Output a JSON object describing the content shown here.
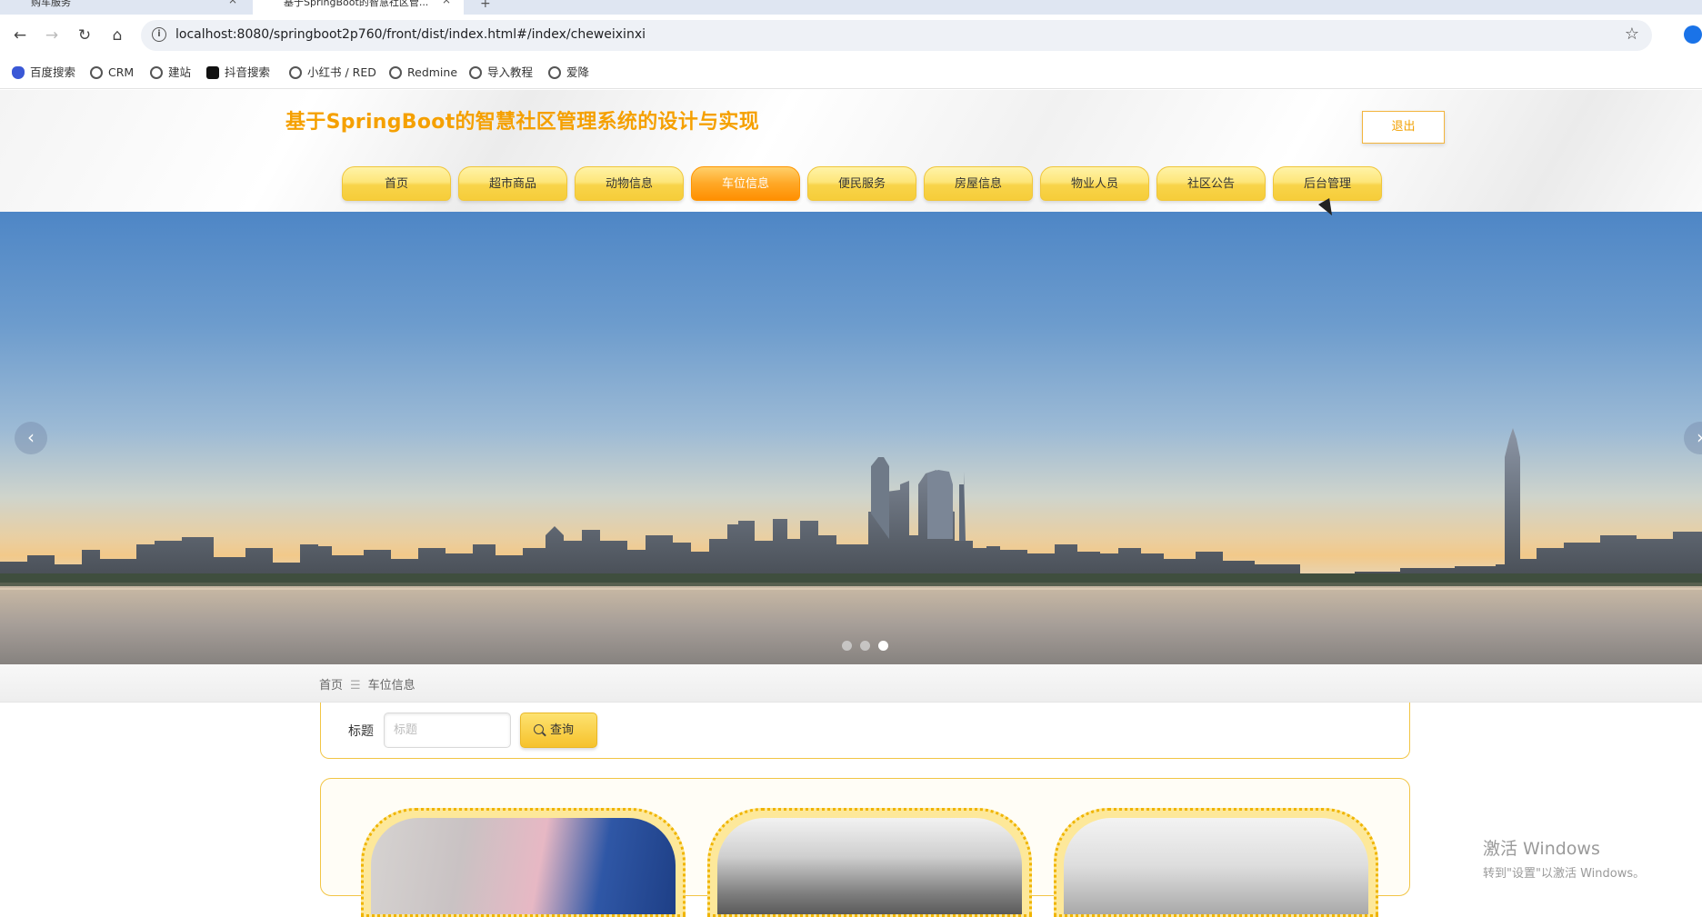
{
  "browser": {
    "tabs": [
      {
        "title": "购车服务"
      },
      {
        "title": "基于SpringBoot的智慧社区管..."
      }
    ],
    "url": "localhost:8080/springboot2p760/front/dist/index.html#/index/cheweixinxi",
    "bookmarks": [
      "百度搜索",
      "CRM",
      "建站",
      "抖音搜索",
      "小红书 / RED",
      "Redmine",
      "导入教程",
      "爱降"
    ]
  },
  "site": {
    "title": "基于SpringBoot的智慧社区管理系统的设计与实现",
    "logout_label": "退出",
    "nav": [
      {
        "label": "首页",
        "active": false
      },
      {
        "label": "超市商品",
        "active": false
      },
      {
        "label": "动物信息",
        "active": false
      },
      {
        "label": "车位信息",
        "active": true
      },
      {
        "label": "便民服务",
        "active": false
      },
      {
        "label": "房屋信息",
        "active": false
      },
      {
        "label": "物业人员",
        "active": false
      },
      {
        "label": "社区公告",
        "active": false
      },
      {
        "label": "后台管理",
        "active": false
      }
    ],
    "accent_color": "#f5a000"
  },
  "banner": {
    "prev_label": "‹",
    "next_label": "›",
    "slides": 3,
    "active_slide": 3
  },
  "breadcrumb": {
    "home": "首页",
    "current": "车位信息"
  },
  "search": {
    "label": "标题",
    "placeholder": "标题",
    "button_label": "查询"
  },
  "cards": [
    {
      "name": "parking-photo-1"
    },
    {
      "name": "parking-photo-2"
    },
    {
      "name": "parking-photo-3"
    }
  ],
  "watermark": {
    "line1": "激活 Windows",
    "line2": "转到\"设置\"以激活 Windows。"
  }
}
